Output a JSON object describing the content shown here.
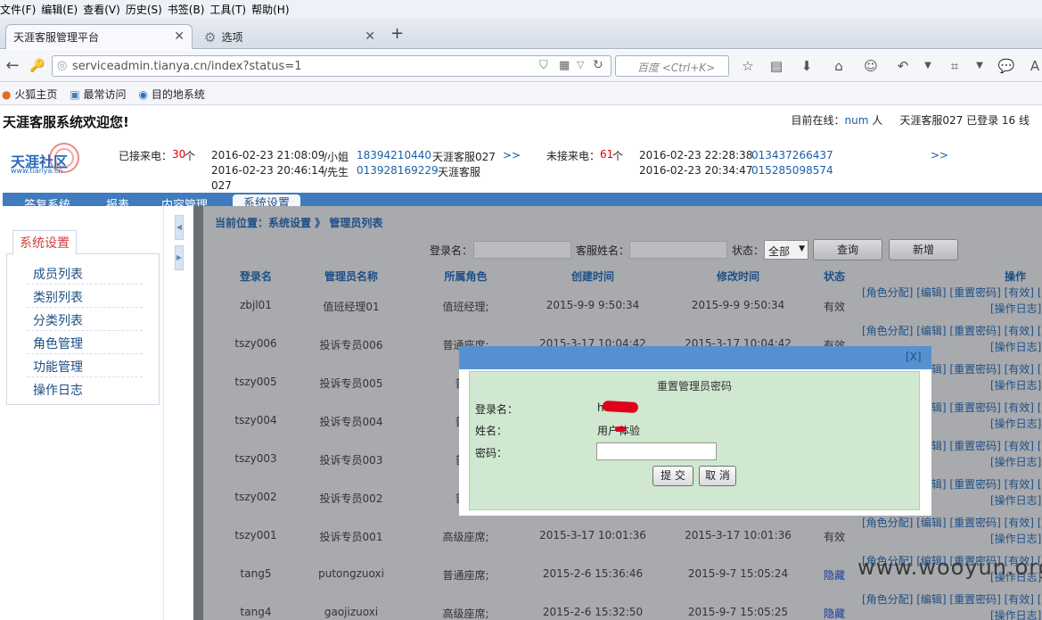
{
  "browser": {
    "menu": [
      "文件(F)",
      "编辑(E)",
      "查看(V)",
      "历史(S)",
      "书签(B)",
      "工具(T)",
      "帮助(H)"
    ],
    "tabs": [
      {
        "label": "天涯客服管理平台",
        "active": true
      },
      {
        "label": "选项",
        "active": false
      }
    ],
    "new_tab_label": "+",
    "url": "serviceadmin.tianya.cn/index?status=1",
    "search_placeholder": "百度 <Ctrl+K>",
    "bookmarks": [
      "火狐主页",
      "最常访问",
      "目的地系统"
    ]
  },
  "header": {
    "welcome": "天涯客服系统欢迎您!",
    "online_prefix": "目前在线：",
    "online_value": "num",
    "online_suffix": "人",
    "logged_in": "天涯客服027 已登录 16 线",
    "logo_text": "天涯社区",
    "logo_url_text": "www.tianya.cn"
  },
  "calls": {
    "answered_label": "已接来电：",
    "answered_count": "30",
    "answered_unit": "个",
    "answered": [
      {
        "time": "2016-02-23 21:08:09",
        "name": "/小姐",
        "phone": "18394210440",
        "agent": "天涯客服027"
      },
      {
        "time": "2016-02-23 20:46:14",
        "name": "/先生",
        "phone": "013928169229",
        "agent": "天涯客服",
        "agent2": "027"
      }
    ],
    "missed_label": "未接来电：",
    "missed_count": "61",
    "missed_unit": "个",
    "missed": [
      {
        "time": "2016-02-23 22:28:38",
        "phone": "013437266437"
      },
      {
        "time": "2016-02-23 20:34:47",
        "phone": "015285098574"
      }
    ],
    "more": ">>"
  },
  "nav": {
    "tabs": [
      "答复系统",
      "报表",
      "内容管理",
      "系统设置"
    ],
    "active": "系统设置"
  },
  "sidebar": {
    "title": "系统设置",
    "items": [
      "成员列表",
      "类别列表",
      "分类列表",
      "角色管理",
      "功能管理",
      "操作日志"
    ]
  },
  "breadcrumb": "当前位置：系统设置 》 管理员列表",
  "filter": {
    "login_label": "登录名：",
    "name_label": "客服姓名：",
    "status_label": "状态：",
    "status_value": "全部",
    "query_button": "查询",
    "add_button": "新增"
  },
  "table": {
    "headers": [
      "登录名",
      "管理员名称",
      "所属角色",
      "创建时间",
      "修改时间",
      "状态",
      "操作"
    ],
    "ops": [
      "[角色分配]",
      "[编辑]",
      "[重置密码]",
      "[有效]",
      "[落",
      "[操作日志]"
    ],
    "rows": [
      {
        "login": "zbjl01",
        "name": "值班经理01",
        "role": "值班经理;",
        "created": "2015-9-9 9:50:34",
        "modified": "2015-9-9 9:50:34",
        "status": "有效"
      },
      {
        "login": "tszy006",
        "name": "投诉专员006",
        "role": "普通座席;",
        "created": "2015-3-17 10:04:42",
        "modified": "2015-3-17 10:04:42",
        "status": "有效"
      },
      {
        "login": "tszy005",
        "name": "投诉专员005",
        "role": "普通",
        "created": "",
        "modified": "",
        "status": ""
      },
      {
        "login": "tszy004",
        "name": "投诉专员004",
        "role": "普通",
        "created": "",
        "modified": "",
        "status": ""
      },
      {
        "login": "tszy003",
        "name": "投诉专员003",
        "role": "普通",
        "created": "",
        "modified": "",
        "status": ""
      },
      {
        "login": "tszy002",
        "name": "投诉专员002",
        "role": "普通",
        "created": "",
        "modified": "",
        "status": ""
      },
      {
        "login": "tszy001",
        "name": "投诉专员001",
        "role": "高级座席;",
        "created": "2015-3-17 10:01:36",
        "modified": "2015-3-17 10:01:36",
        "status": "有效"
      },
      {
        "login": "tang5",
        "name": "putongzuoxi",
        "role": "普通座席;",
        "created": "2015-2-6 15:36:46",
        "modified": "2015-9-7 15:05:24",
        "status": "隐藏"
      },
      {
        "login": "tang4",
        "name": "gaojizuoxi",
        "role": "高级座席;",
        "created": "2015-2-6 15:32:50",
        "modified": "2015-9-7 15:05:25",
        "status": "隐藏"
      }
    ]
  },
  "dialog": {
    "close": "[X]",
    "title": "重置管理员密码",
    "login_label": "登录名：",
    "login_value": "h",
    "name_label": "姓名：",
    "name_value": "用户体验",
    "password_label": "密码：",
    "submit": "提 交",
    "cancel": "取 消"
  },
  "watermark": "www.wooyun.org"
}
